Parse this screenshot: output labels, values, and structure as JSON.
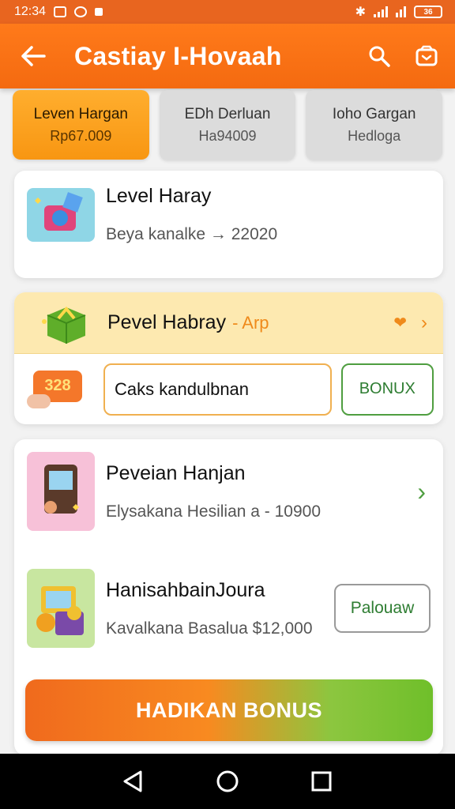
{
  "status_bar": {
    "time": "12:34",
    "battery": "36"
  },
  "app_bar": {
    "title": "Castiay I-Hovaah",
    "icons": [
      "back-arrow-icon",
      "search-icon",
      "wallet-icon"
    ]
  },
  "tabs": [
    {
      "title": "Leven Hargan",
      "value": "Rp67.009",
      "active": true
    },
    {
      "title": "EDh Derluan",
      "value": "Ha94009",
      "active": false
    },
    {
      "title": "Ioho Gargan",
      "value": "Hedloga",
      "active": false
    }
  ],
  "card1": {
    "title": "Level Haray",
    "subtitle": "Beya kanalke → 22020"
  },
  "card2": {
    "title": "Pevel Habray",
    "tag": "- Arp",
    "badge": "328",
    "input_value": "Caks kandulbnan",
    "button": "BONUX"
  },
  "card3": {
    "items": [
      {
        "title": "Peveian Hanjan",
        "subtitle": "Elysakana Hesilian a - 10900"
      },
      {
        "title": "HanisahbainJoura",
        "subtitle": "Kavalkana Basalua $12,000",
        "button": "Palouaw"
      }
    ],
    "cta": "HADIKAN BONUS"
  },
  "colors": {
    "primary": "#f46a10",
    "accent_green": "#4f9e40",
    "tab_active": "#f89612"
  }
}
